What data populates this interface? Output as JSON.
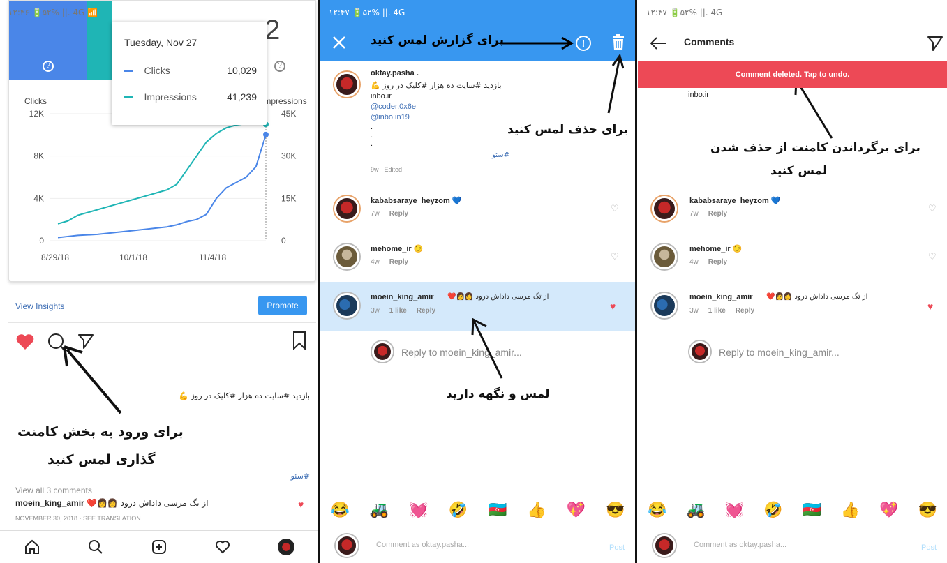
{
  "panel1": {
    "status": "۱۲:۴۶ 🔋۵۲% ||. 4G 📶",
    "card_top": {
      "left_label": "?",
      "right_label": ".2"
    },
    "tooltip": {
      "date": "Tuesday, Nov 27",
      "rows": [
        {
          "label": "Clicks",
          "value": "10,029",
          "color": "#4a86e8"
        },
        {
          "label": "Impressions",
          "value": "41,239",
          "color": "#1fb5b5"
        }
      ]
    },
    "chart_data": {
      "type": "line",
      "x": [
        "8/29/18",
        "10/1/18",
        "11/4/18"
      ],
      "series": [
        {
          "name": "Clicks",
          "axis": "left",
          "color": "#4a86e8",
          "values": [
            300,
            400,
            500,
            550,
            600,
            700,
            800,
            900,
            1000,
            1100,
            1200,
            1300,
            1500,
            1800,
            2000,
            2500,
            4000,
            5000,
            5500,
            6000,
            7000,
            10029
          ]
        },
        {
          "name": "Impressions",
          "axis": "right",
          "color": "#1fb5b5",
          "values": [
            6000,
            7000,
            9000,
            10000,
            11000,
            12000,
            13000,
            14000,
            15000,
            16000,
            17000,
            18000,
            20000,
            25000,
            30000,
            35000,
            38000,
            40000,
            41000,
            41500,
            42000,
            41239
          ]
        }
      ],
      "ylabel_left": "Clicks",
      "ylabel_right": "Impressions",
      "yticks_left": [
        "12K",
        "8K",
        "4K",
        "0"
      ],
      "yticks_right": [
        "45K",
        "30K",
        "15K",
        "0"
      ],
      "ylim_left": [
        0,
        12000
      ],
      "ylim_right": [
        0,
        45000
      ]
    },
    "view_insights": "View Insights",
    "promote": "Promote",
    "caption": "بازدید #سایت ده هزار #کلیک در روز 💪",
    "hashtag": "#سئو",
    "annotation": [
      "برای ورود به بخش کامنت",
      "گذاری لمس کنید"
    ],
    "view_all": "View all 3 comments",
    "last_user": "moein_king_amir",
    "last_text": "از تگ مرسی داداش درود 👩‍👩❤️",
    "date": "NOVEMBER 30, 2018 · SEE TRANSLATION"
  },
  "panel2": {
    "status": "۱۲:۴۷ 🔋۵۲% ||. 4G",
    "annotation_report": "برای گزارش لمس کنید",
    "annotation_delete": "برای حذف لمس کنید",
    "annotation_hold": "لمس و نگهه دارید",
    "post_user": "oktay.pasha .",
    "post_lines": [
      "بازدید #سایت ده هزار #کلیک در روز 💪",
      "inbo.ir",
      "@coder.0x6e",
      "@inbo.in19",
      ".",
      ".",
      "."
    ],
    "post_hashtag": "#سئو",
    "post_meta": "9w · Edited",
    "comments": [
      {
        "user": "kababsaraye_heyzom 💙",
        "time": "7w",
        "reply": "Reply"
      },
      {
        "user": "mehome_ir 😉",
        "time": "4w",
        "reply": "Reply"
      },
      {
        "user": "moein_king_amir",
        "text": "از تگ مرسی داداش درود 👩‍👩❤️",
        "time": "3w",
        "likes": "1 like",
        "reply": "Reply"
      }
    ],
    "reply_placeholder": "Reply to moein_king_amir...",
    "emojis": [
      "😂",
      "🚜",
      "💓",
      "🤣",
      "🇦🇿",
      "👍",
      "💖",
      "😎"
    ],
    "comment_placeholder": "Comment as oktay.pasha...",
    "post_btn": "Post"
  },
  "panel3": {
    "status": "۱۲:۴۷ 🔋۵۲% ||. 4G",
    "title": "Comments",
    "banner": "Comment deleted. Tap to undo.",
    "top_fragment": "inbo.ir",
    "annotation": [
      "برای برگرداندن کامنت از حذف شدن",
      "لمس کنید"
    ],
    "comments": [
      {
        "user": "kababsaraye_heyzom 💙",
        "time": "7w",
        "reply": "Reply"
      },
      {
        "user": "mehome_ir 😉",
        "time": "4w",
        "reply": "Reply"
      },
      {
        "user": "moein_king_amir",
        "text": "از تگ مرسی داداش درود 👩‍👩❤️",
        "time": "3w",
        "likes": "1 like",
        "reply": "Reply"
      }
    ],
    "reply_placeholder": "Reply to moein_king_amir...",
    "emojis": [
      "😂",
      "🚜",
      "💓",
      "🤣",
      "🇦🇿",
      "👍",
      "💖",
      "😎"
    ],
    "comment_placeholder": "Comment as oktay.pasha...",
    "post_btn": "Post"
  }
}
